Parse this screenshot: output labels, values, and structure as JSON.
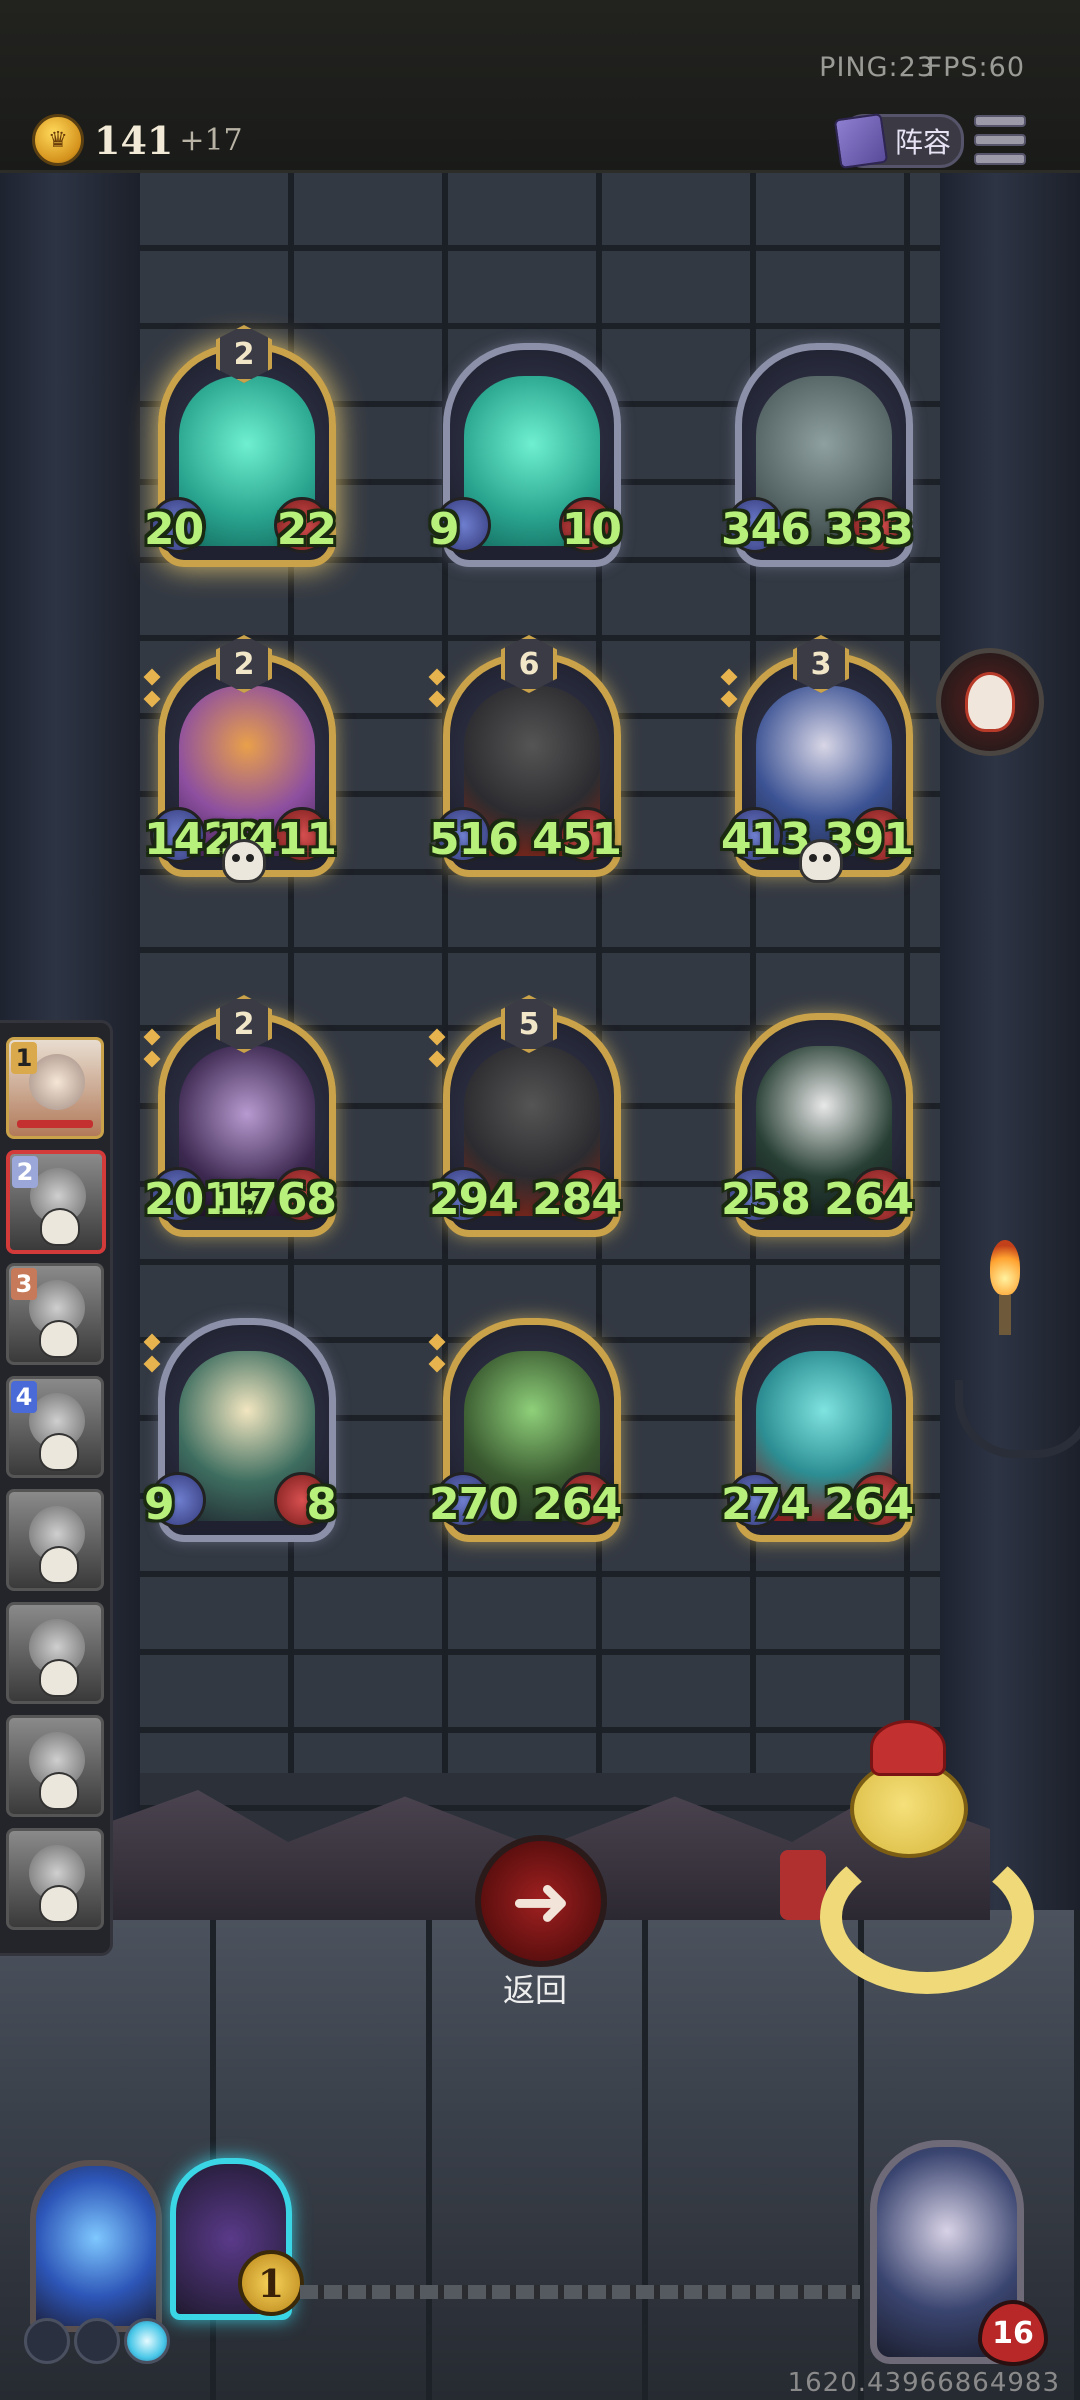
{
  "status": {
    "ping": "PING:23",
    "fps": "FPS:60"
  },
  "currency": {
    "coins": "141",
    "bonus": "+17"
  },
  "header": {
    "lineup_label": "阵容"
  },
  "board": {
    "rows": [
      [
        {
          "tier": "2",
          "attack": "20",
          "health": "22",
          "art": "ghost-king",
          "frame": "gold-glow"
        },
        {
          "tier": "",
          "attack": "9",
          "health": "10",
          "art": "ghost-jester",
          "frame": "silver"
        },
        {
          "tier": "",
          "attack": "346",
          "health": "333",
          "art": "fish-brute",
          "frame": "silver"
        }
      ],
      [
        {
          "tier": "2",
          "attack": "1429",
          "health": "1411",
          "art": "pumpkin-scarecrow",
          "frame": "gold"
        },
        {
          "tier": "6",
          "attack": "516",
          "health": "451",
          "art": "shield-knight",
          "frame": "gold"
        },
        {
          "tier": "3",
          "attack": "413",
          "health": "391",
          "art": "star-wizard",
          "frame": "gold"
        }
      ],
      [
        {
          "tier": "2",
          "attack": "2018",
          "health": "1768",
          "art": "dancing-skeleton",
          "frame": "gold"
        },
        {
          "tier": "5",
          "attack": "294",
          "health": "284",
          "art": "shield-knight",
          "frame": "gold"
        },
        {
          "tier": "",
          "attack": "258",
          "health": "264",
          "art": "reaper",
          "frame": "gold"
        }
      ],
      [
        {
          "tier": "",
          "attack": "9",
          "health": "8",
          "art": "saint",
          "frame": "silver"
        },
        {
          "tier": "",
          "attack": "270",
          "health": "264",
          "art": "plant-knight",
          "frame": "gold"
        },
        {
          "tier": "",
          "attack": "274",
          "health": "264",
          "art": "spirit-summoner",
          "frame": "gold"
        }
      ]
    ]
  },
  "players": [
    {
      "rank": "1",
      "state": "alive",
      "icon": "white-witch-avatar"
    },
    {
      "rank": "2",
      "state": "dead",
      "icon": "knight-avatar"
    },
    {
      "rank": "3",
      "state": "dead",
      "icon": "girl-avatar"
    },
    {
      "rank": "4",
      "state": "dead",
      "icon": "demon-avatar"
    },
    {
      "rank": "",
      "state": "dead",
      "icon": "lady-avatar"
    },
    {
      "rank": "",
      "state": "dead",
      "icon": "elf-avatar"
    },
    {
      "rank": "",
      "state": "dead",
      "icon": "pirate-avatar"
    },
    {
      "rank": "",
      "state": "dead",
      "icon": "hat-avatar"
    }
  ],
  "controls": {
    "back_label": "返回",
    "back_icon": "arrow-left-icon"
  },
  "deck": {
    "portal_count": "1",
    "mana_total": 3,
    "mana_active": 1
  },
  "hero": {
    "health": "16",
    "art": "white-witch"
  },
  "footer": {
    "number": "1620.43966864983"
  }
}
